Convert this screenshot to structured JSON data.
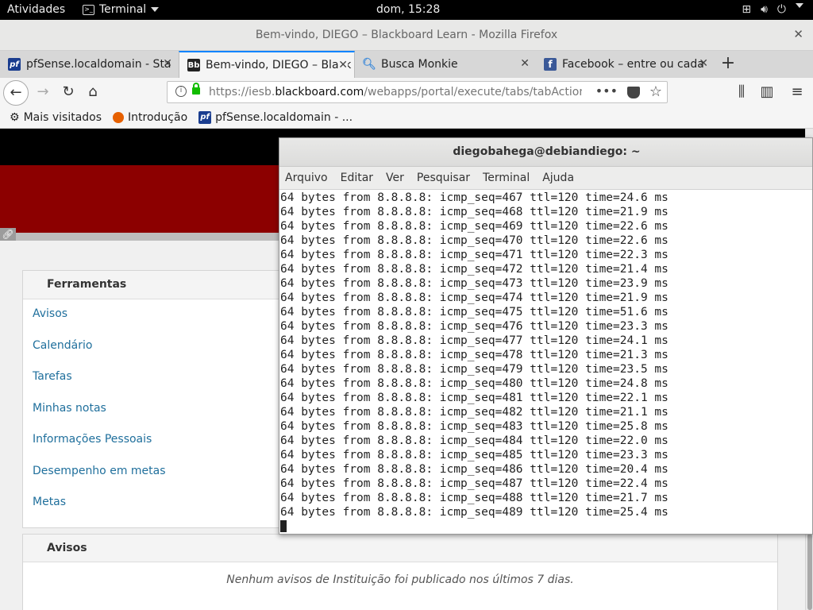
{
  "gnome_bar": {
    "activities": "Atividades",
    "app_menu": "Terminal",
    "clock": "dom, 15:28"
  },
  "firefox": {
    "window_title": "Bem-vindo, DIEGO – Blackboard Learn - Mozilla Firefox",
    "tabs": [
      {
        "label": "pfSense.localdomain - Sta",
        "favicon": "pfsense-icon",
        "active": false
      },
      {
        "label": "Bem-vindo, DIEGO – Black",
        "favicon": "blackboard-icon",
        "active": true
      },
      {
        "label": "Busca Monkie",
        "favicon": "search-icon",
        "active": false
      },
      {
        "label": "Facebook – entre ou cada",
        "favicon": "facebook-icon",
        "active": false
      }
    ],
    "url_prefix": "https://iesb.",
    "url_domain": "blackboard.com",
    "url_rest": "/webapps/portal/execute/tabs/tabAction?tab",
    "bookmarks": [
      {
        "label": "Mais visitados",
        "icon": "gear-icon"
      },
      {
        "label": "Introdução",
        "icon": "firefox-icon"
      },
      {
        "label": "pfSense.localdomain - ...",
        "icon": "pfsense-icon"
      }
    ]
  },
  "page": {
    "tools_title": "Ferramentas",
    "tools": [
      "Avisos",
      "Calendário",
      "Tarefas",
      "Minhas notas",
      "Informações Pessoais",
      "Desempenho em metas",
      "Metas"
    ],
    "avisos_title": "Avisos",
    "avisos_note": "Nenhum avisos de Instituição foi publicado nos últimos 7 dias."
  },
  "terminal": {
    "title": "diegobahega@debiandiego: ~",
    "menu": [
      "Arquivo",
      "Editar",
      "Ver",
      "Pesquisar",
      "Terminal",
      "Ajuda"
    ],
    "lines": [
      "64 bytes from 8.8.8.8: icmp_seq=467 ttl=120 time=24.6 ms",
      "64 bytes from 8.8.8.8: icmp_seq=468 ttl=120 time=21.9 ms",
      "64 bytes from 8.8.8.8: icmp_seq=469 ttl=120 time=22.6 ms",
      "64 bytes from 8.8.8.8: icmp_seq=470 ttl=120 time=22.6 ms",
      "64 bytes from 8.8.8.8: icmp_seq=471 ttl=120 time=22.3 ms",
      "64 bytes from 8.8.8.8: icmp_seq=472 ttl=120 time=21.4 ms",
      "64 bytes from 8.8.8.8: icmp_seq=473 ttl=120 time=23.9 ms",
      "64 bytes from 8.8.8.8: icmp_seq=474 ttl=120 time=21.9 ms",
      "64 bytes from 8.8.8.8: icmp_seq=475 ttl=120 time=51.6 ms",
      "64 bytes from 8.8.8.8: icmp_seq=476 ttl=120 time=23.3 ms",
      "64 bytes from 8.8.8.8: icmp_seq=477 ttl=120 time=24.1 ms",
      "64 bytes from 8.8.8.8: icmp_seq=478 ttl=120 time=21.3 ms",
      "64 bytes from 8.8.8.8: icmp_seq=479 ttl=120 time=23.5 ms",
      "64 bytes from 8.8.8.8: icmp_seq=480 ttl=120 time=24.8 ms",
      "64 bytes from 8.8.8.8: icmp_seq=481 ttl=120 time=22.1 ms",
      "64 bytes from 8.8.8.8: icmp_seq=482 ttl=120 time=21.1 ms",
      "64 bytes from 8.8.8.8: icmp_seq=483 ttl=120 time=25.8 ms",
      "64 bytes from 8.8.8.8: icmp_seq=484 ttl=120 time=22.0 ms",
      "64 bytes from 8.8.8.8: icmp_seq=485 ttl=120 time=23.3 ms",
      "64 bytes from 8.8.8.8: icmp_seq=486 ttl=120 time=20.4 ms",
      "64 bytes from 8.8.8.8: icmp_seq=487 ttl=120 time=22.4 ms",
      "64 bytes from 8.8.8.8: icmp_seq=488 ttl=120 time=21.7 ms",
      "64 bytes from 8.8.8.8: icmp_seq=489 ttl=120 time=25.4 ms"
    ]
  },
  "colors": {
    "bb_red": "#8c0000",
    "link": "#1f6f9c",
    "active_tab_accent": "#0a84ff"
  }
}
